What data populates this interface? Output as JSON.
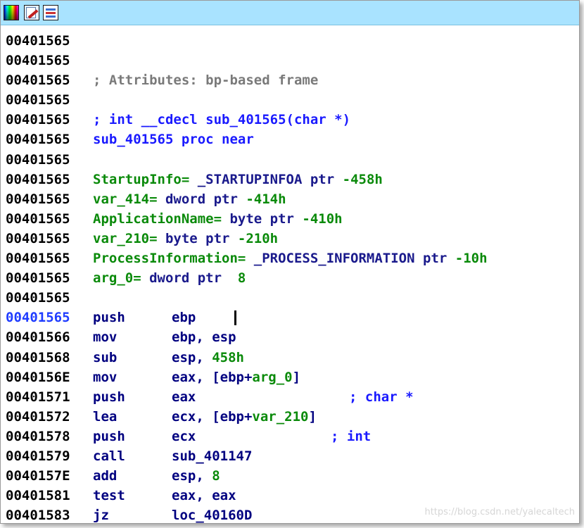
{
  "toolbar": {
    "buttons": [
      {
        "name": "color-palette-icon"
      },
      {
        "name": "edit-function-icon"
      },
      {
        "name": "graph-view-icon"
      }
    ]
  },
  "header_lines": [
    {
      "addr": "00401565",
      "text": ""
    },
    {
      "addr": "00401565",
      "text": ""
    },
    {
      "addr": "00401565",
      "text": "; Attributes: bp-based frame"
    },
    {
      "addr": "00401565",
      "text": ""
    },
    {
      "addr": "00401565",
      "text": "; int __cdecl sub_401565(char *)"
    },
    {
      "addr": "00401565",
      "text": "sub_401565 proc near"
    },
    {
      "addr": "00401565",
      "text": ""
    },
    {
      "addr": "00401565",
      "name": "StartupInfo=",
      "rest": " _STARTUPINFOA ptr ",
      "val": "-458h"
    },
    {
      "addr": "00401565",
      "name": "var_414=",
      "rest": " dword ptr ",
      "val": "-414h"
    },
    {
      "addr": "00401565",
      "name": "ApplicationName=",
      "rest": " byte ptr ",
      "val": "-410h"
    },
    {
      "addr": "00401565",
      "name": "var_210=",
      "rest": " byte ptr ",
      "val": "-210h"
    },
    {
      "addr": "00401565",
      "name": "ProcessInformation=",
      "rest": " _PROCESS_INFORMATION ptr ",
      "val": "-10h"
    },
    {
      "addr": "00401565",
      "name": "arg_0=",
      "rest": " dword ptr  ",
      "val": "8"
    },
    {
      "addr": "00401565",
      "text": ""
    }
  ],
  "instructions": [
    {
      "addr": "00401565",
      "mnemonic": "push",
      "op": "ebp",
      "op2": "",
      "comment": ""
    },
    {
      "addr": "00401566",
      "mnemonic": "mov",
      "op": "ebp, esp",
      "op2": "",
      "comment": ""
    },
    {
      "addr": "00401568",
      "mnemonic": "sub",
      "op": "esp, ",
      "op2": "458h",
      "comment": ""
    },
    {
      "addr": "0040156E",
      "mnemonic": "mov",
      "op": "eax, [ebp+",
      "op2": "arg_0",
      "op3": "]",
      "comment": ""
    },
    {
      "addr": "00401571",
      "mnemonic": "push",
      "op": "eax",
      "op2": "",
      "comment": "; char *"
    },
    {
      "addr": "00401572",
      "mnemonic": "lea",
      "op": "ecx, [ebp+",
      "op2": "var_210",
      "op3": "]",
      "comment": ""
    },
    {
      "addr": "00401578",
      "mnemonic": "push",
      "op": "ecx",
      "op2": "",
      "comment": "; int"
    },
    {
      "addr": "00401579",
      "mnemonic": "call",
      "op": "sub_401147",
      "op2": "",
      "comment": ""
    },
    {
      "addr": "0040157E",
      "mnemonic": "add",
      "op": "esp, ",
      "op2": "8",
      "comment": ""
    },
    {
      "addr": "00401581",
      "mnemonic": "test",
      "op": "eax, eax",
      "op2": "",
      "comment": ""
    },
    {
      "addr": "00401583",
      "mnemonic": "jz",
      "op": "loc_40160D",
      "op2": "",
      "comment": ""
    }
  ],
  "watermark": "https://blog.csdn.net/yalecaltech"
}
